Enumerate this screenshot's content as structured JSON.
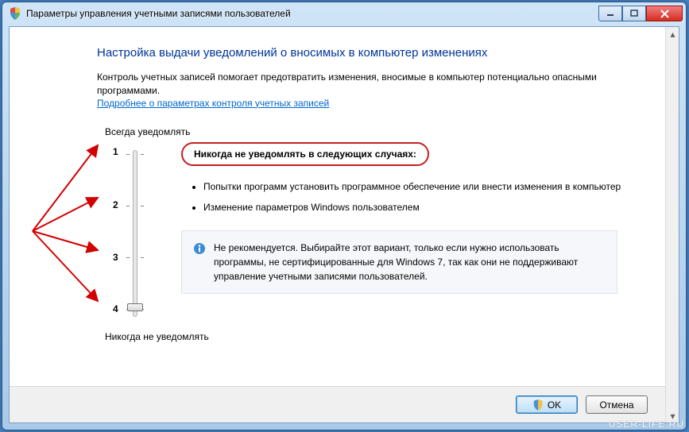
{
  "window": {
    "title": "Параметры управления учетными записями пользователей"
  },
  "heading": "Настройка выдачи уведомлений о вносимых в компьютер изменениях",
  "intro": "Контроль учетных записей помогает предотвратить изменения, вносимые в компьютер потенциально опасными программами.",
  "link": "Подробнее о параметрах контроля учетных записей",
  "slider": {
    "top_label": "Всегда уведомлять",
    "bottom_label": "Никогда не уведомлять",
    "levels": [
      "1",
      "2",
      "3",
      "4"
    ]
  },
  "highlight": "Никогда не уведомлять в следующих случаях:",
  "bullets": [
    "Попытки программ установить программное обеспечение или внести изменения в компьютер",
    "Изменение параметров Windows пользователем"
  ],
  "note": "Не рекомендуется. Выбирайте этот вариант, только если нужно использовать программы, не сертифицированные для Windows 7, так как они не поддерживают управление учетными записями пользователей.",
  "buttons": {
    "ok": "OK",
    "cancel": "Отмена"
  },
  "watermark": "USER-LIFE.RU"
}
